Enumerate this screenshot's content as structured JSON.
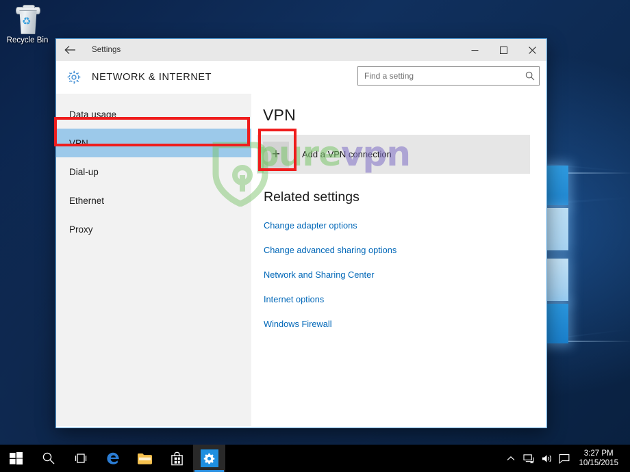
{
  "desktop": {
    "recycle_bin": {
      "label": "Recycle Bin",
      "icon": "recycle-bin-icon"
    }
  },
  "window": {
    "title": "Settings",
    "back_icon": "back-arrow-icon",
    "controls": {
      "minimize": "–",
      "maximize": "☐",
      "close": "✕",
      "minimize_name": "minimize-button",
      "maximize_name": "maximize-button",
      "close_name": "close-button"
    },
    "header": {
      "icon": "gear-icon",
      "title": "NETWORK & INTERNET"
    },
    "search": {
      "placeholder": "Find a setting",
      "value": "",
      "icon": "search-icon"
    }
  },
  "sidebar": {
    "items": [
      {
        "label": "Data usage",
        "selected": false
      },
      {
        "label": "VPN",
        "selected": true
      },
      {
        "label": "Dial-up",
        "selected": false
      },
      {
        "label": "Ethernet",
        "selected": false
      },
      {
        "label": "Proxy",
        "selected": false
      }
    ]
  },
  "content": {
    "title": "VPN",
    "add_vpn": {
      "plus_glyph": "+",
      "label": "Add a VPN connection"
    },
    "related": {
      "title": "Related settings",
      "links": [
        "Change adapter options",
        "Change advanced sharing options",
        "Network and Sharing Center",
        "Internet options",
        "Windows Firewall"
      ]
    }
  },
  "annotations": {
    "color": "#ef1d1d",
    "boxes": [
      {
        "target": "sidebar-item-vpn"
      },
      {
        "target": "add-vpn-plus-button"
      }
    ]
  },
  "watermark": {
    "text_primary": "pure",
    "text_secondary": "vpn",
    "color_primary": "#7ac46a",
    "color_secondary": "#7e6ec4"
  },
  "taskbar": {
    "items": [
      {
        "name": "start-button",
        "icon": "windows-logo-icon",
        "active": false
      },
      {
        "name": "search-button",
        "icon": "search-icon",
        "active": false
      },
      {
        "name": "task-view-button",
        "icon": "task-view-icon",
        "active": false
      },
      {
        "name": "edge-button",
        "icon": "edge-icon",
        "active": false
      },
      {
        "name": "file-explorer-button",
        "icon": "folder-icon",
        "active": false
      },
      {
        "name": "store-button",
        "icon": "store-bag-icon",
        "active": false
      },
      {
        "name": "settings-taskbar-button",
        "icon": "gear-icon",
        "active": true
      }
    ],
    "tray": {
      "chevron": "show-hidden-icons-icon",
      "network": "network-icon",
      "volume": "volume-icon",
      "action_center": "action-center-icon",
      "time": "3:27 PM",
      "date": "10/15/2015"
    }
  }
}
